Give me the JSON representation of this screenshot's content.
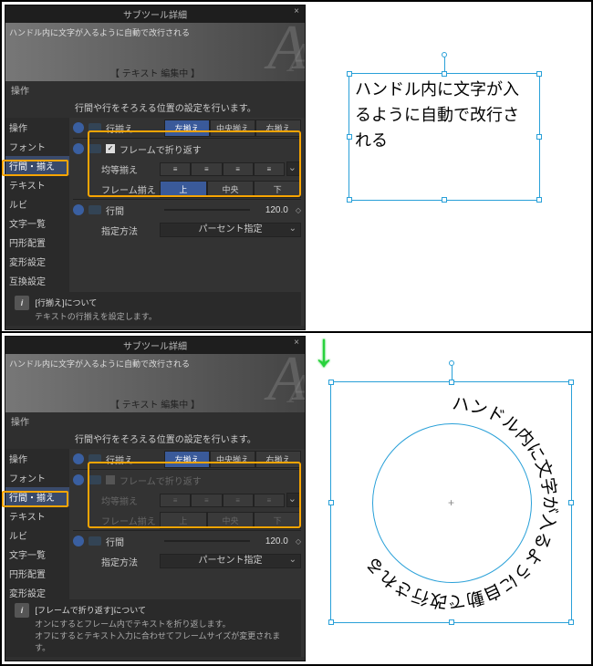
{
  "window_title": "サブツール詳細",
  "preview_text": "ハンドル内に文字が入るように自動で改行される",
  "editing_label": "【 テキスト 編集中 】",
  "ops_label": "操作",
  "description": "行間や行をそろえる位置の設定を行います。",
  "sidebar": [
    "操作",
    "フォント",
    "行間・揃え",
    "テキスト",
    "ルビ",
    "文字一覧",
    "円形配置",
    "変形設定",
    "互換設定"
  ],
  "sidebar_selected": "行間・揃え",
  "align_row": {
    "label": "行揃え",
    "opts": [
      "左揃え",
      "中央揃え",
      "右揃え"
    ],
    "selected": 0
  },
  "wrap_label": "フレームで折り返す",
  "wrap_checked_top": true,
  "wrap_checked_bottom": false,
  "justify_label": "均等揃え",
  "frame_align": {
    "label": "フレーム揃え",
    "opts": [
      "上",
      "中央",
      "下"
    ],
    "selected": 0
  },
  "linegap": {
    "label": "行間",
    "value": "120.0"
  },
  "spec": {
    "label": "指定方法",
    "value": "パーセント指定"
  },
  "info_top": {
    "title": "[行揃え]について",
    "body": "テキストの行揃えを設定します。"
  },
  "info_bottom": {
    "title": "[フレームで折り返す]について",
    "body1": "オンにするとフレーム内でテキストを折り返します。",
    "body2": "オフにするとテキスト入力に合わせてフレームサイズが変更されます。"
  },
  "canvas_text": "ハンドル内に文字が入るように自動で改行される",
  "circle_text": "ハンドル内に文字が入るように自動で改行される"
}
